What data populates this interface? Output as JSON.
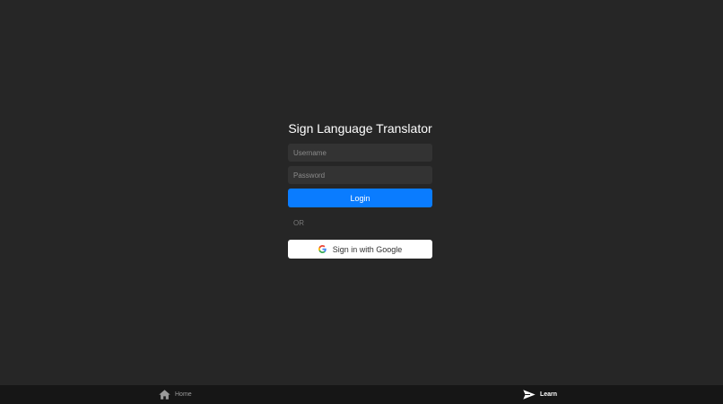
{
  "app": {
    "title": "Sign Language Translator"
  },
  "login_form": {
    "username_placeholder": "Username",
    "password_placeholder": "Password",
    "login_label": "Login",
    "divider_text": "OR",
    "google_label": "Sign in with Google",
    "google_icon": "google-g-icon"
  },
  "tab_bar": {
    "items": [
      {
        "label": "Home",
        "icon": "home-icon",
        "active": false
      },
      {
        "label": "Learn",
        "icon": "paper-plane-icon",
        "active": true
      }
    ]
  },
  "colors": {
    "background": "#262626",
    "input_background": "#333333",
    "primary": "#0a7cff",
    "tab_bar_background": "#161616"
  }
}
